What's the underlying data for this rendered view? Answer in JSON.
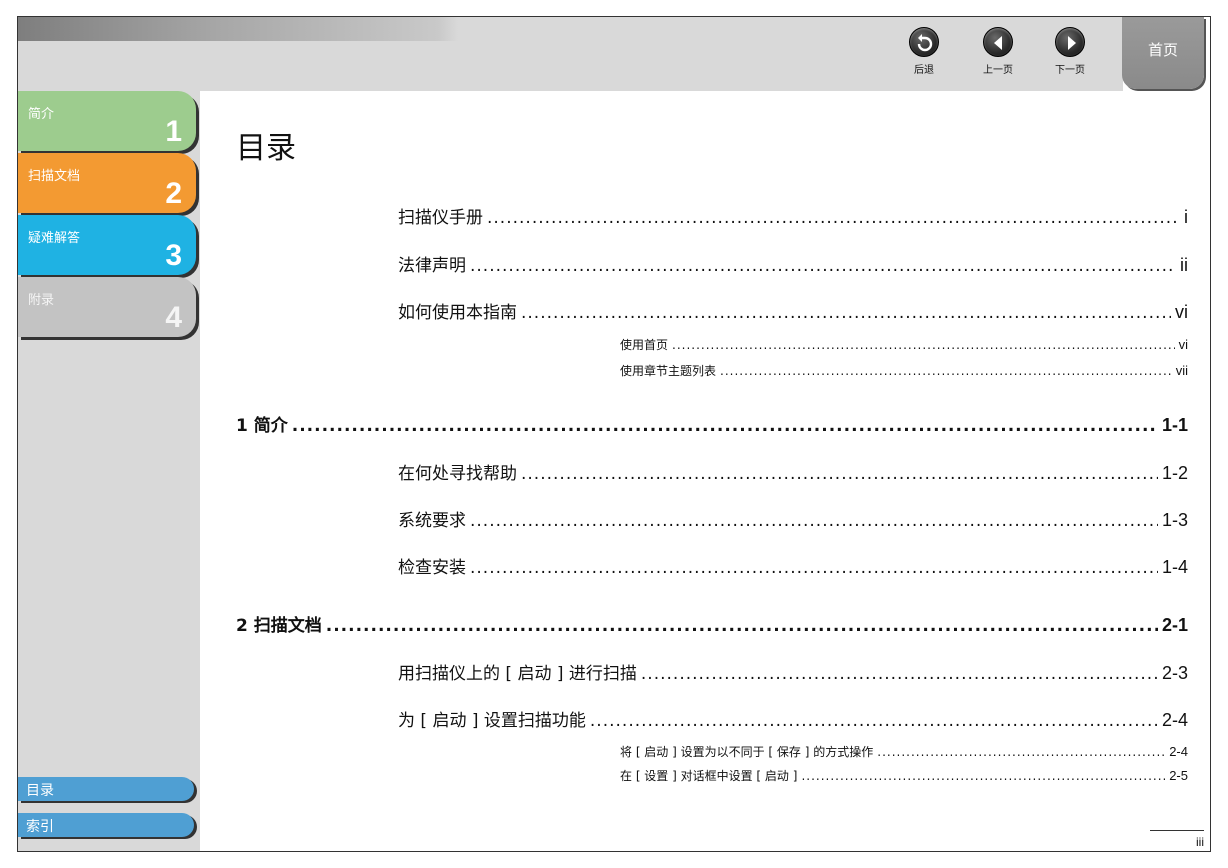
{
  "nav": {
    "back_label": "后退",
    "prev_label": "上一页",
    "next_label": "下一页",
    "home_label": "首页"
  },
  "sidebar": {
    "chapters": [
      {
        "title": "简介",
        "number": "1"
      },
      {
        "title": "扫描文档",
        "number": "2"
      },
      {
        "title": "疑难解答",
        "number": "3"
      },
      {
        "title": "附录",
        "number": "4"
      }
    ],
    "toc_label": "目录",
    "index_label": "索引"
  },
  "main": {
    "title": "目录",
    "entries": [
      {
        "label": "扫描仪手册",
        "page": "i"
      },
      {
        "label": "法律声明",
        "page": "ii"
      },
      {
        "label": "如何使用本指南",
        "page": "vi"
      },
      {
        "label": "使用首页",
        "page": "vi"
      },
      {
        "label": "使用章节主题列表",
        "page": "vii"
      },
      {
        "label": "1 简介",
        "page": "1-1"
      },
      {
        "label": "在何处寻找帮助",
        "page": "1-2"
      },
      {
        "label": "系统要求",
        "page": "1-3"
      },
      {
        "label": "检查安装",
        "page": "1-4"
      },
      {
        "label": "2 扫描文档",
        "page": "2-1"
      },
      {
        "label": "用扫描仪上的 [ 启动 ] 进行扫描",
        "page": "2-3"
      },
      {
        "label": "为 [ 启动 ] 设置扫描功能",
        "page": "2-4"
      },
      {
        "label": "将 [ 启动 ] 设置为以不同于 [ 保存 ] 的方式操作",
        "page": "2-4"
      },
      {
        "label": "在 [ 设置 ] 对话框中设置 [ 启动 ]",
        "page": "2-5"
      }
    ],
    "page_number": "iii"
  },
  "colors": {
    "tab1": "#9dcc8e",
    "tab2": "#f39a32",
    "tab3": "#1fb2e3",
    "tab4": "#c3c3c3",
    "bottom_tabs": "#4f9fd3"
  }
}
